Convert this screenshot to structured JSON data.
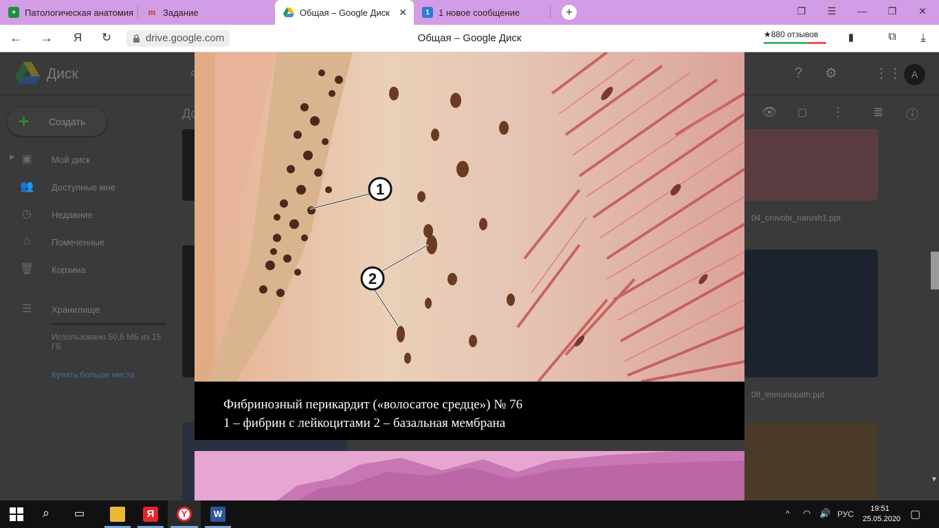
{
  "browser": {
    "tabs": [
      {
        "label": "Патологическая анатомия",
        "icon": "sheets-icon",
        "active": false
      },
      {
        "label": "Задание",
        "icon": "moodle-icon",
        "active": false
      },
      {
        "label": "Общая – Google Диск",
        "icon": "google-drive-icon",
        "active": true,
        "close": "✕"
      },
      {
        "label": "1 новое сообщение",
        "icon": "message-icon",
        "badge": "1",
        "active": false
      }
    ],
    "new_tab": "+",
    "url": "drive.google.com",
    "page_title": "Общая – Google Диск",
    "reviews": "★880 отзывов"
  },
  "drive": {
    "brand": "Диск",
    "avatar_letter": "A",
    "create_label": "Создать",
    "sidebar": [
      {
        "label": "Мой диск",
        "icon": "my-drive-icon"
      },
      {
        "label": "Доступные мне",
        "icon": "shared-icon"
      },
      {
        "label": "Недавние",
        "icon": "clock-icon"
      },
      {
        "label": "Помеченные",
        "icon": "star-icon"
      },
      {
        "label": "Корзина",
        "icon": "trash-icon"
      }
    ],
    "storage_label": "Хранилище",
    "storage_used": "Использовано 50,6 МБ из 15 ГБ",
    "buy_more": "Купить больше места",
    "breadcrumb_fragment": "До",
    "files": [
      "04_crovobr_narush1.ppt",
      "08_immunopath.ppt"
    ]
  },
  "viewer": {
    "marker_1": "1",
    "marker_2": "2",
    "caption_line1": "Фибринозный перикардит («волосатое средце») № 76",
    "caption_line2": "1 – фибрин с лейкоцитами 2 – базальная мембрана"
  },
  "taskbar": {
    "language": "РУС",
    "time": "19:51",
    "date": "25.05.2020"
  },
  "colors": {
    "tabbar": "#d39ce6",
    "drive_dim": "#3a3a3a",
    "caption_bg": "#000000",
    "tissue_pink": "#e8b9a6",
    "tissue_red": "#c24e4e"
  }
}
